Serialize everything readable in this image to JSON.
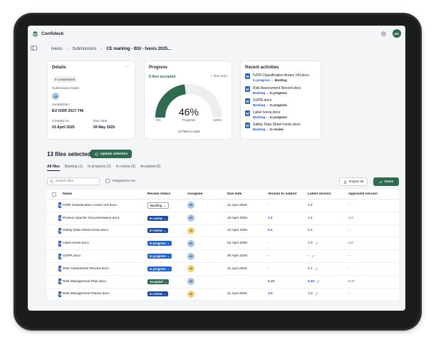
{
  "app": {
    "name": "Confideck",
    "user_initials": "DC"
  },
  "breadcrumb": [
    "Ivexis",
    "Submissions",
    "CE marking - BSI - Ivexis 2025..."
  ],
  "details": {
    "title": "Details",
    "status": "In preparation",
    "leads_label": "Submission leads:",
    "leads": [
      "LP"
    ],
    "jurisdiction_label": "Jurisdiction:",
    "jurisdiction": "EU IVDR 2017-746",
    "created_label": "Created on",
    "created": "03 April 2025",
    "due_label": "Due date:",
    "due": "09 May 2025"
  },
  "progress": {
    "title": "Progress",
    "accepted": "6 files accepted",
    "todo": "7 files todo",
    "percent": 46,
    "percent_label": "46%",
    "label": "Progress",
    "min_label": "0%",
    "max_label": "100%",
    "total": "13 files in total"
  },
  "recent": {
    "title": "Recent activities",
    "items": [
      {
        "name": "IVDR Classification Annex VIII.docx",
        "from": "In progress",
        "to": "Backlog"
      },
      {
        "name": "Risk Assessment Record.docx",
        "from": "Backlog",
        "to": "In progress"
      },
      {
        "name": "GSPR.docx",
        "from": "Backlog",
        "to": "In progress"
      },
      {
        "name": "Label Ivexis.docx",
        "from": "Backlog",
        "to": "In progress"
      },
      {
        "name": "Safety Data Sheet Ivexis.docx",
        "from": "Backlog",
        "to": "In review"
      }
    ]
  },
  "files": {
    "heading": "13 files selected",
    "update_label": "Update selection",
    "tabs": [
      "All files",
      "Backlog (1)",
      "In progress (3)",
      "In review (3)",
      "Accepted (6)"
    ],
    "search_placeholder": "Search files",
    "assigned_label": "Assigned to me",
    "export_label": "Export all",
    "done_label": "Done",
    "columns": [
      "Name",
      "Review status",
      "Assignee",
      "Due date",
      "Version to submit",
      "Latest version",
      "Approved version"
    ],
    "rows": [
      {
        "name": "IVDR Classification Annex VIII.docx",
        "status": "Backlog",
        "status_key": "backlog",
        "assignee": "LP",
        "due": "11 April 2025",
        "submit": "-",
        "latest": "1.2",
        "approved": "-"
      },
      {
        "name": "Product Specific Documentation.docx",
        "status": "In review",
        "status_key": "inreview",
        "assignee": "LP",
        "due": "18 April 2025",
        "submit": "1.1",
        "latest": "1.1",
        "approved": "1.0"
      },
      {
        "name": "Safety Data Sheet Ivexis.docx",
        "status": "In review",
        "status_key": "inreview",
        "assignee": "JS",
        "due": "12 April 2025",
        "submit": "0.1",
        "latest": "0.1",
        "approved": "-"
      },
      {
        "name": "Label Ivexis.docx",
        "status": "In progress",
        "status_key": "inprogress",
        "assignee": "LP",
        "due": "04 April 2025",
        "submit": "-",
        "latest": "1.0",
        "approved": "1.0"
      },
      {
        "name": "GSPR.docx",
        "status": "In progress",
        "status_key": "inprogress",
        "assignee": "LP",
        "due": "05 April 2025",
        "submit": "-",
        "latest": "-",
        "approved": "-"
      },
      {
        "name": "Risk Assessment Record.docx",
        "status": "In progress",
        "status_key": "inprogress",
        "assignee": "JS",
        "due": "11 April 2025",
        "submit": "-",
        "latest": "0.1",
        "approved": "-"
      },
      {
        "name": "Risk Management Plan.docx",
        "status": "Accepted",
        "status_key": "accepted",
        "assignee": "LP",
        "due": "",
        "submit": "0.20",
        "latest": "0.24",
        "approved": "0.17"
      },
      {
        "name": "Risk Management Report.docx",
        "status": "In review",
        "status_key": "inreview",
        "assignee": "JS",
        "due": "11 April 2025",
        "submit": "1.0",
        "latest": "1.0",
        "approved": "-"
      }
    ]
  },
  "colors": {
    "brand": "#2f6b4f",
    "progress_track": "#eceef0",
    "status_blue": "#1e4ba0"
  }
}
